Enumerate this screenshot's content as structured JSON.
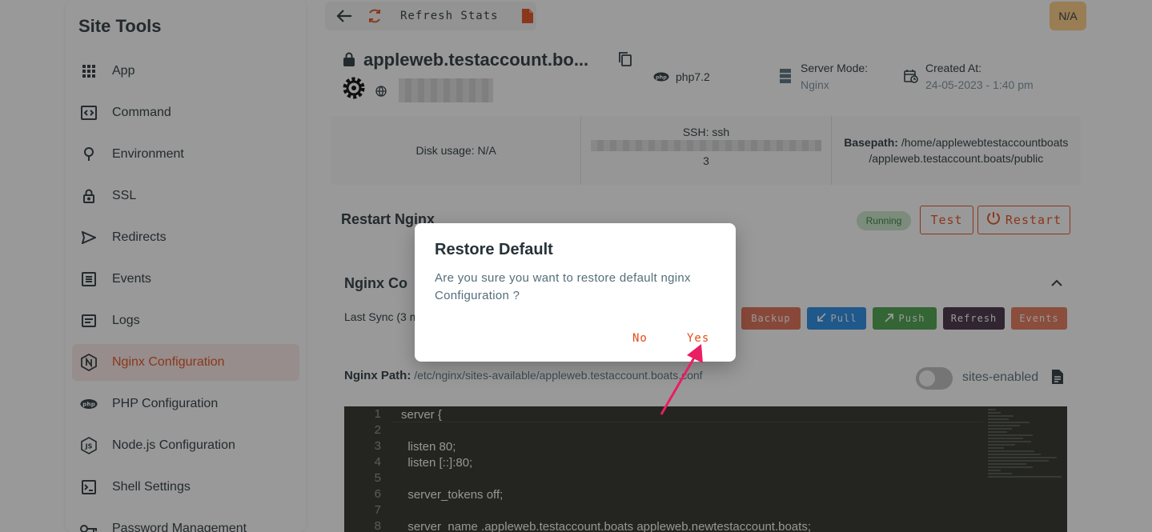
{
  "sidebar": {
    "title": "Site Tools",
    "items": [
      {
        "label": "App",
        "icon": "grid-icon"
      },
      {
        "label": "Command",
        "icon": "code-box-icon"
      },
      {
        "label": "Environment",
        "icon": "leaf-icon"
      },
      {
        "label": "SSL",
        "icon": "lock-icon"
      },
      {
        "label": "Redirects",
        "icon": "send-icon"
      },
      {
        "label": "Events",
        "icon": "list-icon"
      },
      {
        "label": "Logs",
        "icon": "log-icon"
      },
      {
        "label": "Nginx Configuration",
        "icon": "nginx-icon",
        "active": true
      },
      {
        "label": "PHP Configuration",
        "icon": "php-icon"
      },
      {
        "label": "Node.js Configuration",
        "icon": "nodejs-icon"
      },
      {
        "label": "Shell Settings",
        "icon": "terminal-icon"
      },
      {
        "label": "Password Management",
        "icon": "key-icon"
      }
    ]
  },
  "toolbar": {
    "refresh_label": "Refresh Stats",
    "na_badge": "N/A"
  },
  "site": {
    "domain": "appleweb.testaccount.bo...",
    "php_version": "php7.2",
    "server_mode_label": "Server Mode:",
    "server_mode_value": "Nginx",
    "created_label": "Created At:",
    "created_value": "24-05-2023 - 1:40 pm"
  },
  "stats": {
    "disk_usage": "Disk usage: N/A",
    "ssh_label": "SSH: ssh",
    "ssh_suffix": "3",
    "basepath_label": "Basepath:",
    "basepath_value_1": "/home/applewebtestaccountboats",
    "basepath_value_2": "/appleweb.testaccount.boats/public"
  },
  "restart": {
    "title": "Restart Nginx",
    "status": "Running",
    "test_label": "Test",
    "restart_label": "Restart"
  },
  "config": {
    "title": "Nginx Co",
    "last_sync": "Last Sync (3 m",
    "buttons": {
      "backup": "Backup",
      "pull": "Pull",
      "push": "Push",
      "refresh": "Refresh",
      "events": "Events"
    },
    "path_label": "Nginx Path:",
    "path_value": "/etc/nginx/sites-available/appleweb.testaccount.boats.conf",
    "toggle_label": "sites-enabled"
  },
  "editor": {
    "lines": [
      {
        "n": "1",
        "text": "server {"
      },
      {
        "n": "2",
        "text": ""
      },
      {
        "n": "3",
        "text": "  listen 80;"
      },
      {
        "n": "4",
        "text": "  listen [::]:80;"
      },
      {
        "n": "5",
        "text": ""
      },
      {
        "n": "6",
        "text": "  server_tokens off;"
      },
      {
        "n": "7",
        "text": ""
      },
      {
        "n": "8",
        "text": "  server_name .appleweb.testaccount.boats appleweb.newtestaccount.boats;"
      }
    ]
  },
  "dialog": {
    "title": "Restore Default",
    "message": "Are you sure you want to restore default nginx Configuration ?",
    "no_label": "No",
    "yes_label": "Yes"
  },
  "colors": {
    "accent": "#e64a19",
    "backup_btn": "#e06a4e",
    "pull_btn": "#1e88e5",
    "push_btn": "#43a047",
    "refresh_btn": "#3e2a3d",
    "events_btn": "#e57354",
    "annotation_arrow": "#e91e63"
  }
}
